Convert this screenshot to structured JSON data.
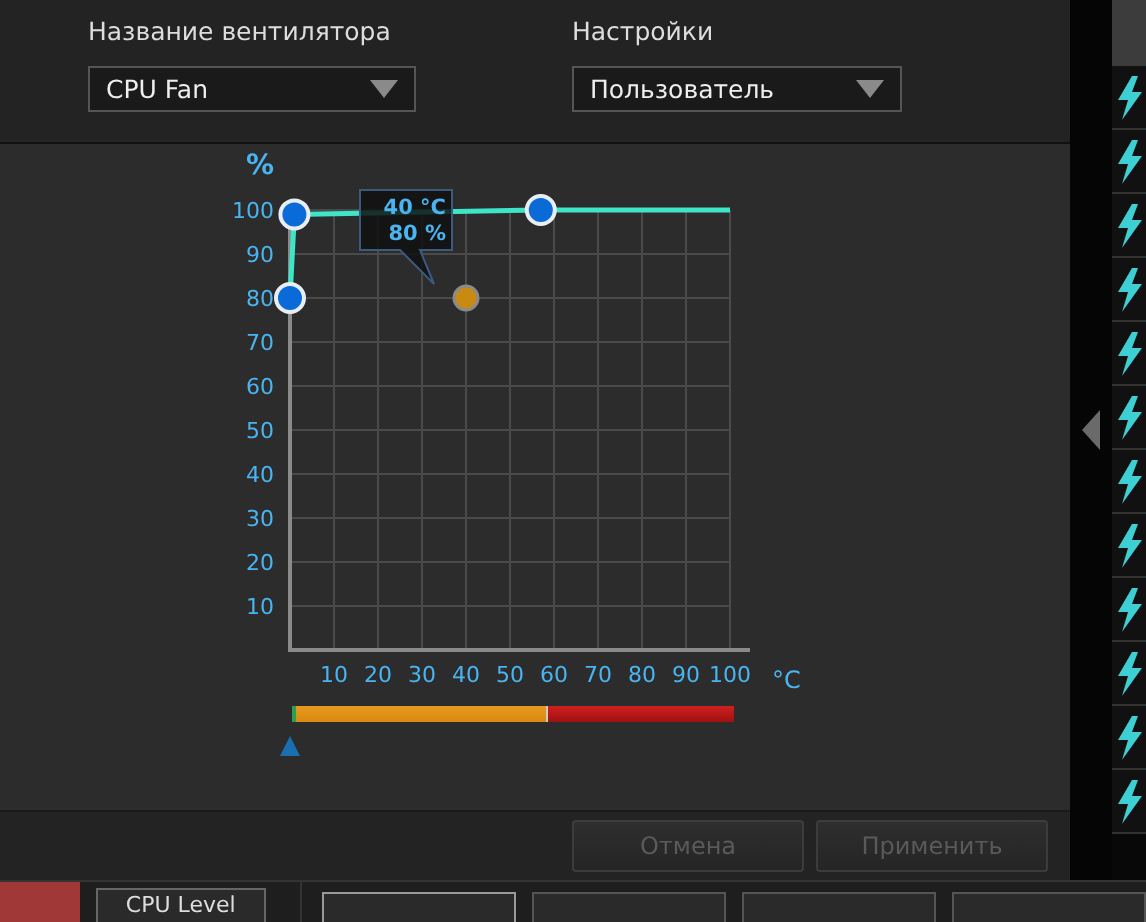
{
  "fan_name": {
    "label": "Название вентилятора",
    "value": "CPU Fan"
  },
  "settings": {
    "label": "Настройки",
    "value": "Пользователь"
  },
  "chart": {
    "chart_data": {
      "type": "line",
      "ylabel": "%",
      "xlabel": "°C",
      "grid": true,
      "x": [
        0,
        1,
        40,
        57,
        100
      ],
      "series": [
        {
          "marker": "circle",
          "color": "#3ee6c8",
          "values": [
            80,
            99,
            null,
            100,
            100
          ]
        },
        {
          "marker": "circle",
          "color": "#c98a14",
          "values": [
            null,
            null,
            80,
            null,
            null
          ]
        }
      ],
      "xlim": [
        0,
        100
      ],
      "ylim": [
        0,
        100
      ],
      "xticks": [
        10,
        20,
        30,
        40,
        50,
        60,
        70,
        80,
        90,
        100
      ],
      "yticks": [
        10,
        20,
        30,
        40,
        50,
        60,
        70,
        80,
        90,
        100
      ]
    },
    "tooltip": [
      "40 °C",
      "80 %"
    ]
  },
  "zone_bar": {
    "level": 0.57
  },
  "buttons": [
    {
      "label": "Отмена",
      "disabled": true
    },
    {
      "label": "Применить",
      "disabled": true
    }
  ],
  "bottom_tabs": [
    {
      "kind": "red"
    },
    {
      "kind": "button",
      "label": "CPU Level"
    },
    {
      "kind": "blank",
      "selected": true
    },
    {
      "kind": "blank",
      "selected": false
    },
    {
      "kind": "blank",
      "selected": false
    },
    {
      "kind": "blank",
      "selected": false
    }
  ]
}
